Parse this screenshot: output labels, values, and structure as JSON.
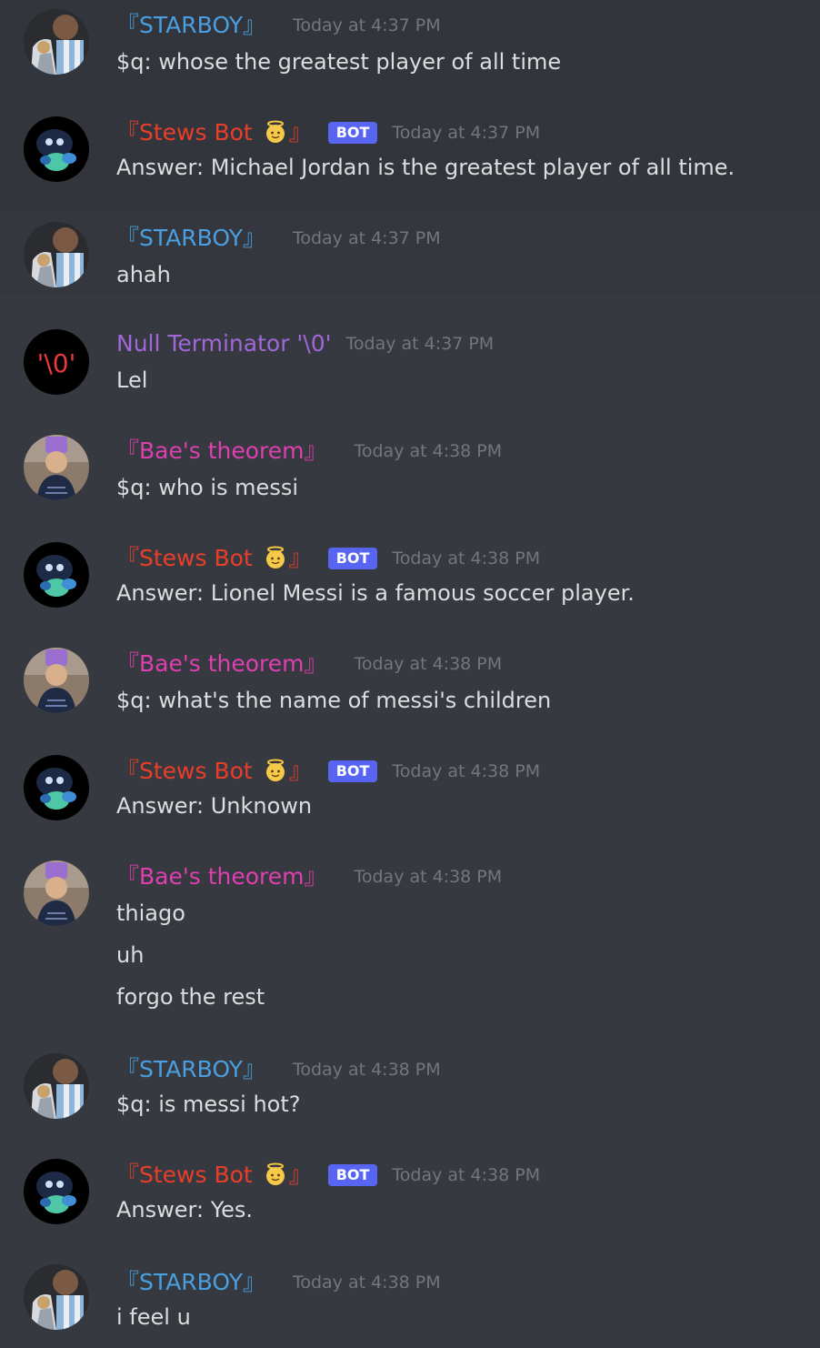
{
  "bot_badge": "BOT",
  "messages": [
    {
      "author": "『STARBOY』",
      "time": "Today at 4:37 PM",
      "lines": [
        "$q: whose the greatest player of all time"
      ]
    },
    {
      "author": "『Stews Bot ",
      "author_end": "』",
      "time": "Today at 4:37 PM",
      "lines": [
        "Answer:  Michael Jordan is the greatest player of all time."
      ]
    },
    {
      "author": "『STARBOY』",
      "time": "Today at 4:37 PM",
      "lines": [
        "ahah"
      ]
    },
    {
      "author": "Null Terminator '\\0'",
      "time": "Today at 4:37 PM",
      "lines": [
        "Lel"
      ]
    },
    {
      "author": "『Bae's theorem』",
      "time": "Today at 4:38 PM",
      "lines": [
        "$q: who is messi"
      ]
    },
    {
      "author": "『Stews Bot ",
      "author_end": "』",
      "time": "Today at 4:38 PM",
      "lines": [
        "Answer:  Lionel Messi is a famous soccer player."
      ]
    },
    {
      "author": "『Bae's theorem』",
      "time": "Today at 4:38 PM",
      "lines": [
        "$q: what's the name of messi's children"
      ]
    },
    {
      "author": "『Stews Bot ",
      "author_end": "』",
      "time": "Today at 4:38 PM",
      "lines": [
        "Answer:  Unknown"
      ]
    },
    {
      "author": "『Bae's theorem』",
      "time": "Today at 4:38 PM",
      "lines": [
        "thiago",
        "uh",
        "forgo the rest"
      ]
    },
    {
      "author": "『STARBOY』",
      "time": "Today at 4:38 PM",
      "lines": [
        "$q: is messi hot?"
      ]
    },
    {
      "author": "『Stews Bot ",
      "author_end": "』",
      "time": "Today at 4:38 PM",
      "lines": [
        "Answer:  Yes."
      ]
    },
    {
      "author": "『STARBOY』",
      "time": "Today at 4:38 PM",
      "lines": [
        "i feel u"
      ]
    }
  ],
  "avatar_text": {
    "null_terminator": "'\\0'"
  },
  "icons": {
    "bot_name_emoji": "angel-emoji-icon"
  },
  "colors": {
    "background": "#36393f",
    "highlight": "#32353b",
    "starboy": "#4a9fe0",
    "stews_bot": "#ea3e2a",
    "null_terminator": "#a167d9",
    "baes_theorem": "#df3fb0",
    "bot_badge": "#5865f2",
    "timestamp": "#72767d",
    "message_text": "#dcddde"
  }
}
